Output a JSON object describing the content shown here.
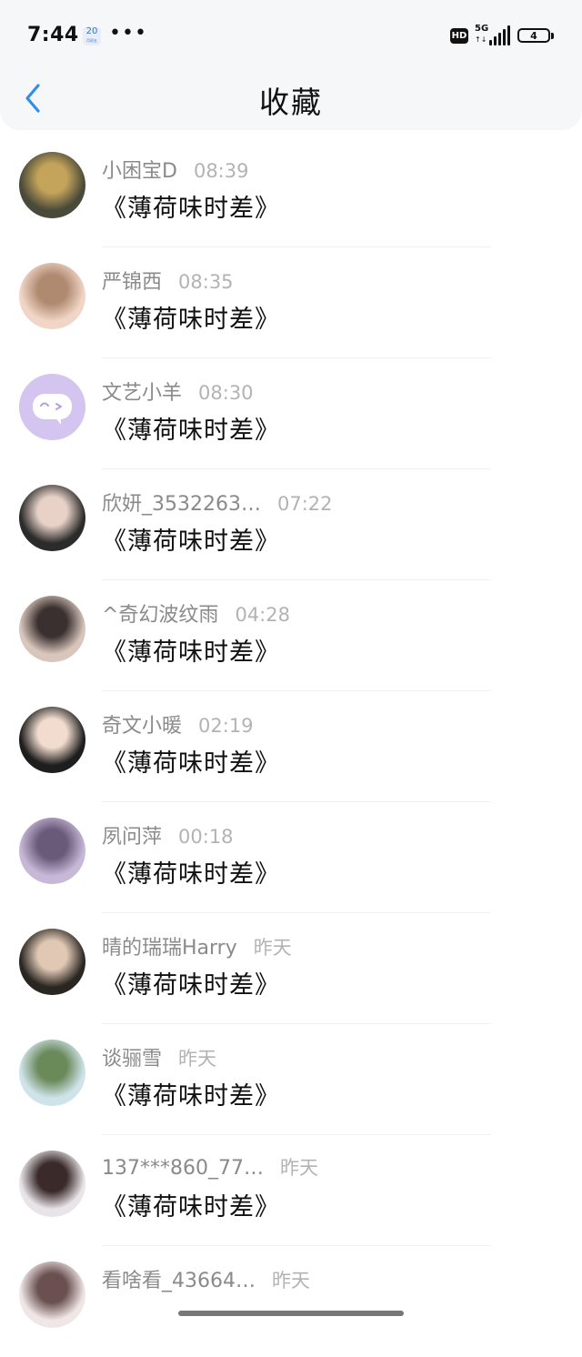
{
  "status_bar": {
    "time": "7:44",
    "calendar_badge": "20",
    "calendar_sub": "月初五",
    "more": "•••",
    "hd": "HD",
    "network": "5G",
    "arrows": "↑↓",
    "battery": "4"
  },
  "header": {
    "back_icon": "chevron-left-icon",
    "title": "收藏",
    "accent_color": "#2f8fea"
  },
  "items": [
    {
      "name": "小困宝D",
      "time": "08:39",
      "content": "《薄荷味时差》",
      "avatar_colors": [
        "#4a4a3a",
        "#c4a45a"
      ]
    },
    {
      "name": "严锦西",
      "time": "08:35",
      "content": "《薄荷味时差》",
      "avatar_colors": [
        "#f1d6c8",
        "#b08a70"
      ]
    },
    {
      "name": "文艺小羊",
      "time": "08:30",
      "content": "《薄荷味时差》",
      "avatar_colors": [
        "#d4c4f0",
        "#ffffff"
      ]
    },
    {
      "name": "欣妍_3532263…",
      "time": "07:22",
      "content": "《薄荷味时差》",
      "avatar_colors": [
        "#2b2b2b",
        "#e8d2c8"
      ]
    },
    {
      "name": "^奇幻波纹雨",
      "time": "04:28",
      "content": "《薄荷味时差》",
      "avatar_colors": [
        "#d8c5bb",
        "#3a3030"
      ]
    },
    {
      "name": "奇文小暖",
      "time": "02:19",
      "content": "《薄荷味时差》",
      "avatar_colors": [
        "#1e1e1e",
        "#f2dccf"
      ]
    },
    {
      "name": "夙问萍",
      "time": "00:18",
      "content": "《薄荷味时差》",
      "avatar_colors": [
        "#c8b8d8",
        "#6a5a7a"
      ]
    },
    {
      "name": "晴的瑞瑞Harry",
      "time": "昨天",
      "content": "《薄荷味时差》",
      "avatar_colors": [
        "#2a2622",
        "#e0c8b4"
      ]
    },
    {
      "name": "谈骊雪",
      "time": "昨天",
      "content": "《薄荷味时差》",
      "avatar_colors": [
        "#cfe3ea",
        "#6a8a5a"
      ]
    },
    {
      "name": "137***860_77…",
      "time": "昨天",
      "content": "《薄荷味时差》",
      "avatar_colors": [
        "#e8e4e8",
        "#3a2a2a"
      ]
    },
    {
      "name": "看啥看_43664…",
      "time": "昨天",
      "content": "",
      "avatar_colors": [
        "#f0e6e6",
        "#6a5050"
      ]
    }
  ]
}
